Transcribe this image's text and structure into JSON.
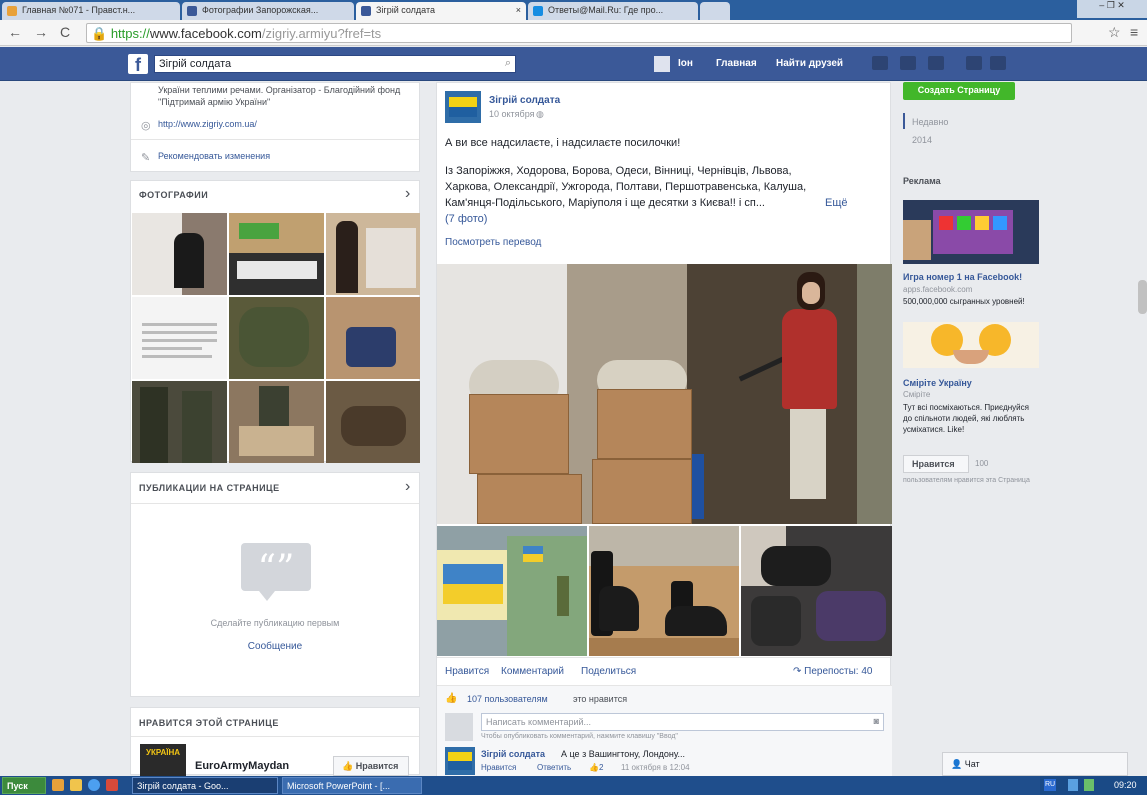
{
  "browser": {
    "tabs": [
      {
        "label": "Главная №071 - Правст.н...",
        "active": false
      },
      {
        "label": "Фотографии Запорожская...",
        "active": false
      },
      {
        "label": "Зігрій солдата",
        "active": true
      },
      {
        "label": "Ответы@Mail.Ru: Где про...",
        "active": false
      }
    ],
    "tab_close": "×",
    "url_scheme": "https://",
    "url_host": "www.facebook.com",
    "url_path": "/zigriy.armiyu?fref=ts",
    "back": "←",
    "forward": "→",
    "reload": "C",
    "star": "☆",
    "menu": "≡",
    "win_controls": "–  ❐  ✕"
  },
  "fb": {
    "logo": "f",
    "search_value": "Зігрій солдата",
    "nav_me": "Іон",
    "nav_home": "Главная",
    "nav_friends": "Найти друзей"
  },
  "left": {
    "about_text": "України теплими речами. Організатор - Благодійний фонд \"Підтримай армію України\"",
    "website": "http://www.zigriy.com.ua/",
    "suggest_edits": "Рекомендовать изменения",
    "photos_header": "ФОТОГРАФИИ",
    "posts_header": "ПУБЛИКАЦИИ НА СТРАНИЦЕ",
    "posts_empty": "Сделайте публикацию первым",
    "posts_link": "Сообщение",
    "likes_header": "НРАВИТСЯ ЭТОЙ СТРАНИЦЕ",
    "liked_page_name": "EuroArmyMaydan",
    "liked_page_logo": "УКРАЇНА",
    "liked_page_button": "Нравится",
    "chevron": "›"
  },
  "post": {
    "page_name": "Зігрій солдата",
    "date": "10 октября",
    "text_line1": "А ви все надсилаєте, і надсилаєте посилочки!",
    "text_line2": "Із Запоріжжя, Ходорова, Борова, Одеси, Вінниці, Чернівців, Львова,",
    "text_line3": "Харкова, Олександрії, Ужгорода, Полтави, Першотравенська, Калуша,",
    "text_line4": "Кам'янця-Подільського, Маріуполя і ще десятки з Києва!! і сп...",
    "more": "Ещё",
    "photo_count": "(7 фото)",
    "translate": "Посмотреть перевод",
    "action_like": "Нравится",
    "action_comment": "Комментарий",
    "action_share": "Поделиться",
    "reposts": "Перепосты: 40",
    "likes_count": "107 пользователям",
    "likes_suffix": "это нравится",
    "comment_placeholder": "Написать комментарий...",
    "comment_hint": "Чтобы опубликовать комментарий, нажмите клавишу \"Ввод\"",
    "reply_author": "Зігрій солдата",
    "reply_text": "А це з Вашингтону, Лондону...",
    "reply_like": "Нравится",
    "reply_answer": "Ответить",
    "reply_count": "2",
    "reply_date": "11 октября в 12:04"
  },
  "right": {
    "create_page": "Создать Страницу",
    "recent": "Недавно",
    "year": "2014",
    "ads_header": "Реклама",
    "ad1_title": "Игра номер 1 на Facebook!",
    "ad1_url": "apps.facebook.com",
    "ad1_desc": "500,000,000 сыгранных уровней!",
    "ad2_title": "Сміріте Україну",
    "ad2_sub": "Сміріте",
    "ad2_desc": "Тут всі посміхаються. Приєднуйся до спільноти людей, які люблять усміхатися. Like!",
    "ad2_button": "Нравится",
    "ad2_count": "100",
    "ad2_note": "пользователям нравится эта Страница",
    "chat": "Чат"
  },
  "taskbar": {
    "start": "Пуск",
    "item1": "Зігрій солдата - Goo...",
    "item2": "Microsoft PowerPoint - [...",
    "tray_lang": "RU",
    "clock": "09:20"
  },
  "colors": {
    "fb_blue": "#3b5998",
    "link": "#365899",
    "create_green": "#42b72a"
  }
}
